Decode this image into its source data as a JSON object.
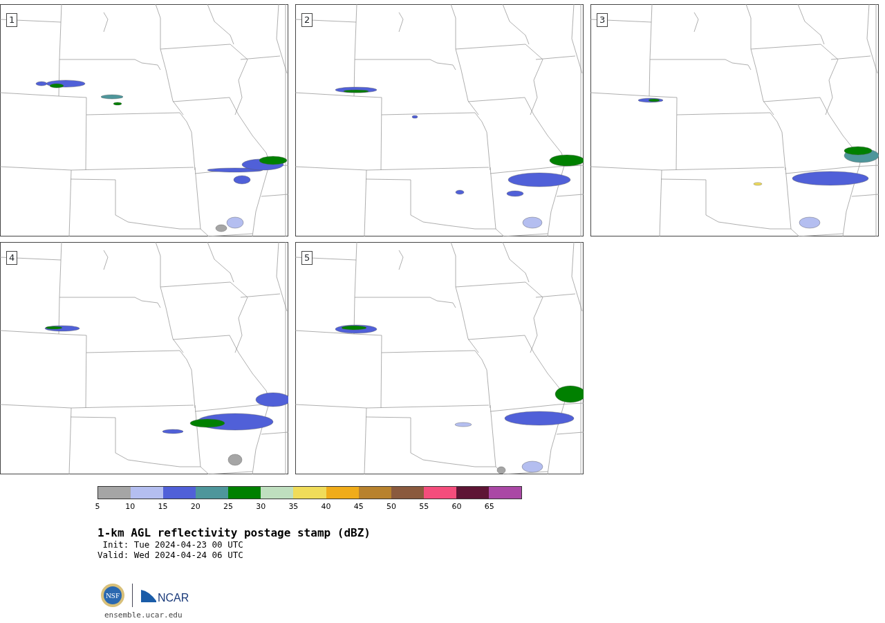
{
  "panels": [
    {
      "label": "1"
    },
    {
      "label": "2"
    },
    {
      "label": "3"
    },
    {
      "label": "4"
    },
    {
      "label": "5"
    }
  ],
  "colorbar": {
    "bins": [
      {
        "color": "#a5a5a5"
      },
      {
        "color": "#b4bef0"
      },
      {
        "color": "#5060d8"
      },
      {
        "color": "#4e969b"
      },
      {
        "color": "#008000"
      },
      {
        "color": "#bfdfbf"
      },
      {
        "color": "#f0dc5a"
      },
      {
        "color": "#f0ac1a"
      },
      {
        "color": "#b8822e"
      },
      {
        "color": "#8a5a3e"
      },
      {
        "color": "#f44d7c"
      },
      {
        "color": "#5e1535"
      },
      {
        "color": "#aa48a5"
      }
    ],
    "ticks": [
      "5",
      "10",
      "15",
      "20",
      "25",
      "30",
      "35",
      "40",
      "45",
      "50",
      "55",
      "60",
      "65"
    ]
  },
  "title": "1-km AGL reflectivity postage stamp (dBZ)",
  "init": " Init: Tue 2024-04-23 00 UTC",
  "valid": "Valid: Wed 2024-04-24 06 UTC",
  "logos": {
    "nsf_text": "NSF",
    "ncar_text": "NCAR"
  },
  "url": "ensemble.ucar.edu"
}
